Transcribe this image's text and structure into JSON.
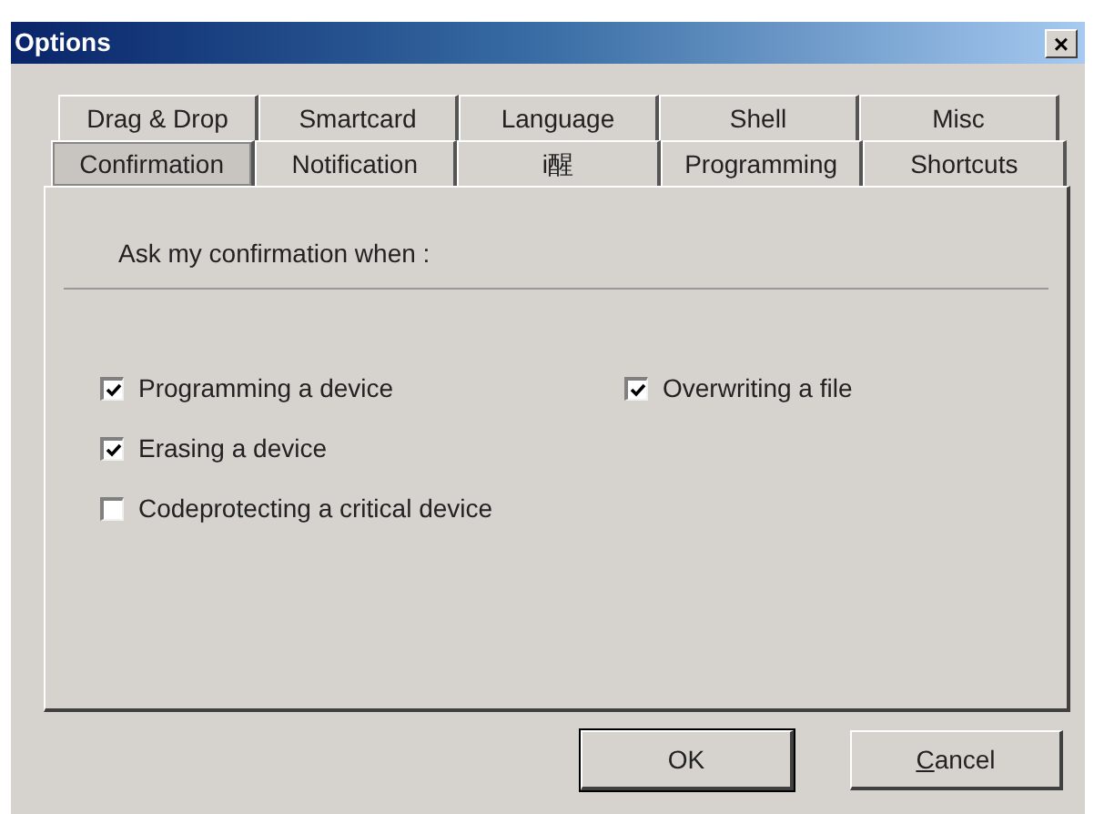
{
  "window": {
    "title": "Options",
    "close": "×"
  },
  "tab_rows": [
    [
      {
        "label": "Drag & Drop",
        "selected": false
      },
      {
        "label": "Smartcard",
        "selected": false
      },
      {
        "label": "Language",
        "selected": false
      },
      {
        "label": "Shell",
        "selected": false
      },
      {
        "label": "Misc",
        "selected": false
      }
    ],
    [
      {
        "label": "Confirmation",
        "selected": true
      },
      {
        "label": "Notification",
        "selected": false
      },
      {
        "label": "i醒",
        "selected": false
      },
      {
        "label": "Programming",
        "selected": false
      },
      {
        "label": "Shortcuts",
        "selected": false
      }
    ]
  ],
  "group_label": "Ask my confirmation when :",
  "options_left": [
    {
      "label": "Programming a device",
      "checked": true
    },
    {
      "label": "Erasing a device",
      "checked": true
    },
    {
      "label": "Codeprotecting a critical device",
      "checked": false
    }
  ],
  "options_right": [
    {
      "label": "Overwriting a file",
      "checked": true
    }
  ],
  "buttons": [
    {
      "label": "OK",
      "default": true
    },
    {
      "label": "Cancel",
      "default": false
    }
  ]
}
